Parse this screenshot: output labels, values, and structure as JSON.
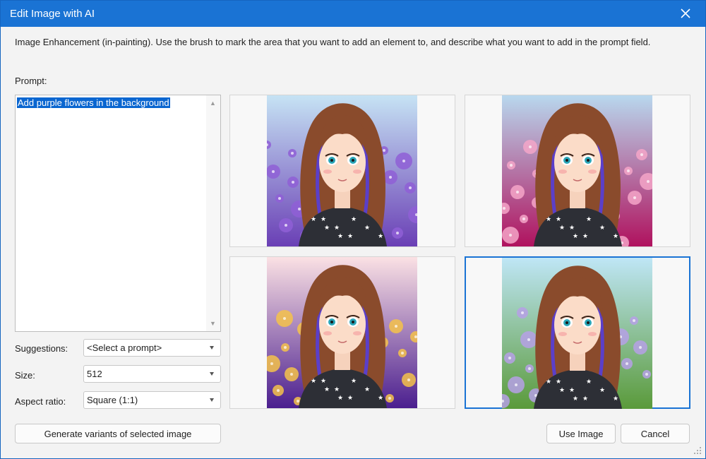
{
  "window": {
    "title": "Edit Image with AI",
    "accent_color": "#1a73d4"
  },
  "description": "Image Enhancement (in-painting). Use the brush to mark the area that you want to add an element to, and describe what you want to add in the prompt field.",
  "prompt": {
    "label": "Prompt:",
    "value": "Add purple flowers in the background"
  },
  "fields": {
    "suggestions": {
      "label": "Suggestions:",
      "value": "<Select a prompt>"
    },
    "size": {
      "label": "Size:",
      "value": "512"
    },
    "aspect_ratio": {
      "label": "Aspect ratio:",
      "value": "Square (1:1)"
    }
  },
  "buttons": {
    "generate": "Generate variants of selected image",
    "use_image": "Use Image",
    "cancel": "Cancel"
  },
  "images": [
    {
      "variant": "purple-flowers-field",
      "selected": false,
      "bg_top": "#c6e3f4",
      "bg_bottom": "#6a3fb5",
      "accent": "#8f5fd6"
    },
    {
      "variant": "pink-flowers-fence",
      "selected": false,
      "bg_top": "#b8d8ee",
      "bg_bottom": "#b0125e",
      "accent": "#f4a6c8"
    },
    {
      "variant": "floral-frame-circle",
      "selected": false,
      "bg_top": "#fbe1e4",
      "bg_bottom": "#4b1f8f",
      "accent": "#f4c24a"
    },
    {
      "variant": "garden-petals",
      "selected": true,
      "bg_top": "#bfe6f6",
      "bg_bottom": "#5a9a3a",
      "accent": "#b6a0e6"
    }
  ],
  "icons": {
    "close": "close-icon",
    "scroll_up": "scroll-up-arrow-icon",
    "scroll_down": "scroll-down-arrow-icon",
    "dropdown": "chevron-down-icon",
    "resize": "resize-grip-icon"
  }
}
